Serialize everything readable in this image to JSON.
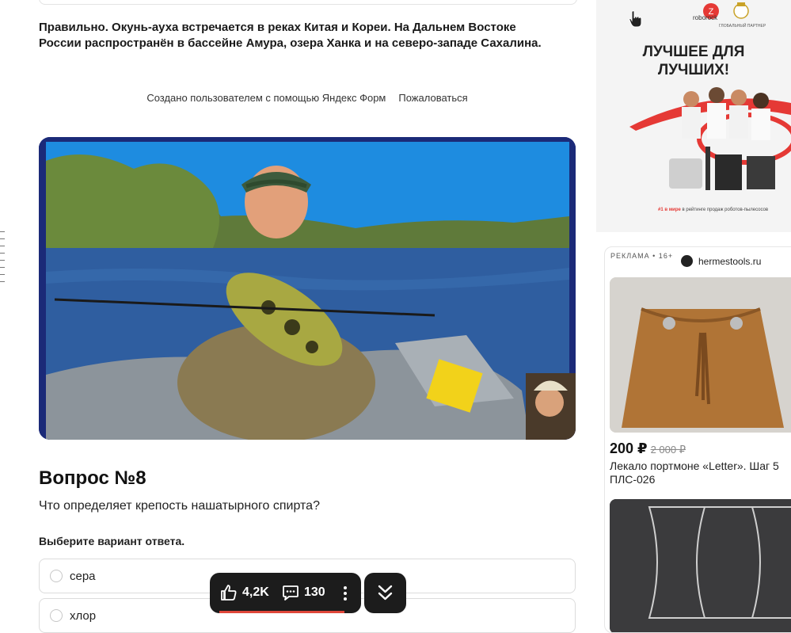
{
  "answer": {
    "text": "Правильно. Окунь-ауха встречается в реках Китая и Кореи. На Дальнем Востоке России распространён в бассейне Амура, озера Ханка и на северо-западе Сахалина."
  },
  "footer": {
    "created_by": "Создано пользователем с помощью Яндекс Форм",
    "report": "Пожаловаться"
  },
  "question": {
    "title": "Вопрос №8",
    "text": "Что определяет крепость нашатырного спирта?",
    "hint": "Выберите вариант ответа.",
    "options": [
      "сера",
      "хлор"
    ]
  },
  "action_bar": {
    "likes": "4,2K",
    "comments": "130",
    "progress": 1.0
  },
  "ad_banner": {
    "brand": "roborock",
    "partner": "ГЛОБАЛЬНЫЙ ПАРТНЕР",
    "headline_line1": "ЛУЧШЕЕ ДЛЯ",
    "headline_line2": "ЛУЧШИХ!",
    "rank": "#1 в мире",
    "rank_rest": "в рейтинге продаж роботов-пылесосов"
  },
  "ad_card": {
    "label": "РЕКЛАМА • 16+",
    "site": "hermestools.ru",
    "price": "200 ₽",
    "old_price": "2 000 ₽",
    "name_line1": "Лекало портмоне «Letter». Шаг 5",
    "name_line2": "ПЛС-026"
  },
  "colors": {
    "dark_bar": "#1c1c1c",
    "progress": "#e0473a",
    "video_frame": "#1b2a78"
  }
}
